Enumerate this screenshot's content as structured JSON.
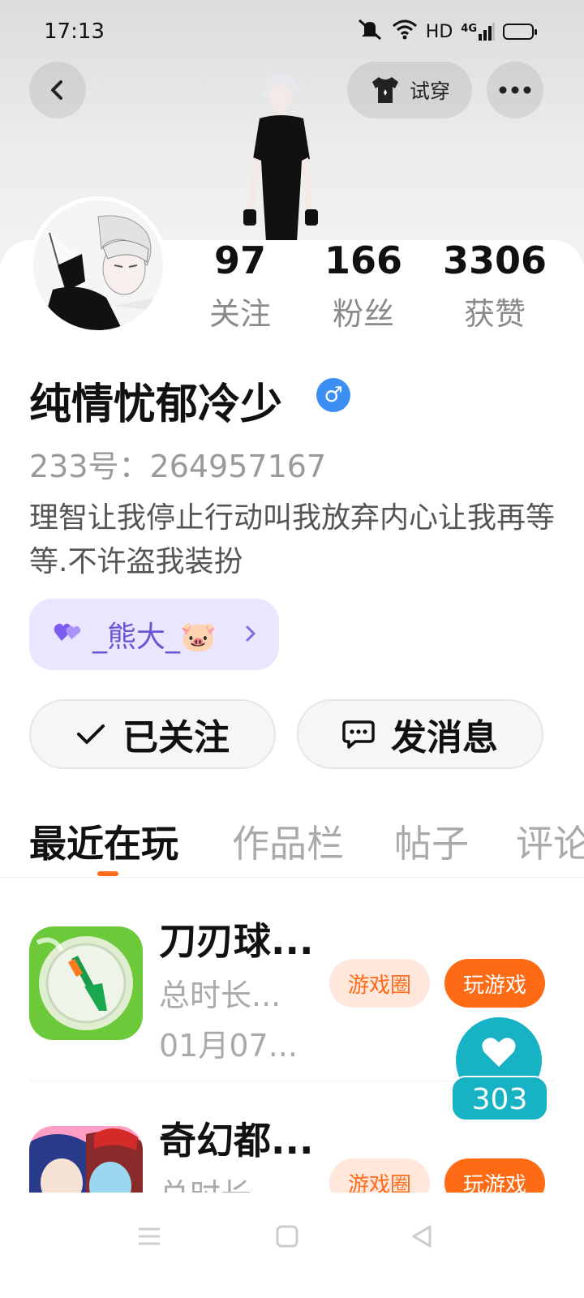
{
  "status_bar": {
    "time": "17:13",
    "network_label": "HD",
    "signal_label": "4G"
  },
  "header": {
    "try_on_label": "试穿"
  },
  "stats": [
    {
      "value": "97",
      "label": "关注"
    },
    {
      "value": "166",
      "label": "粉丝"
    },
    {
      "value": "3306",
      "label": "获赞"
    }
  ],
  "profile": {
    "username": "纯情忧郁冷少",
    "gender_symbol": "♂",
    "uid": "233号：264957167",
    "bio": "理智让我停止行动叫我放弃内心让我再等等.不许盗我装扮",
    "bond_tag": "_熊大_🐷"
  },
  "actions": {
    "followed_label": "已关注",
    "message_label": "发消息"
  },
  "tabs": [
    "最近在玩",
    "作品栏",
    "帖子",
    "评论"
  ],
  "games": [
    {
      "title": "刀刃球...",
      "duration": "总时长...",
      "date": "01月07...",
      "circle_label": "游戏圈",
      "play_label": "玩游戏"
    },
    {
      "title": "奇幻都...",
      "duration": "总时长",
      "date": "",
      "circle_label": "游戏圈",
      "play_label": "玩游戏"
    }
  ],
  "like_float": {
    "count": "303"
  },
  "colors": {
    "accent": "#ff6a15",
    "like_teal": "#17b2c4",
    "bond_purple": "#6b57d6",
    "gender_blue": "#3d8ef3"
  }
}
